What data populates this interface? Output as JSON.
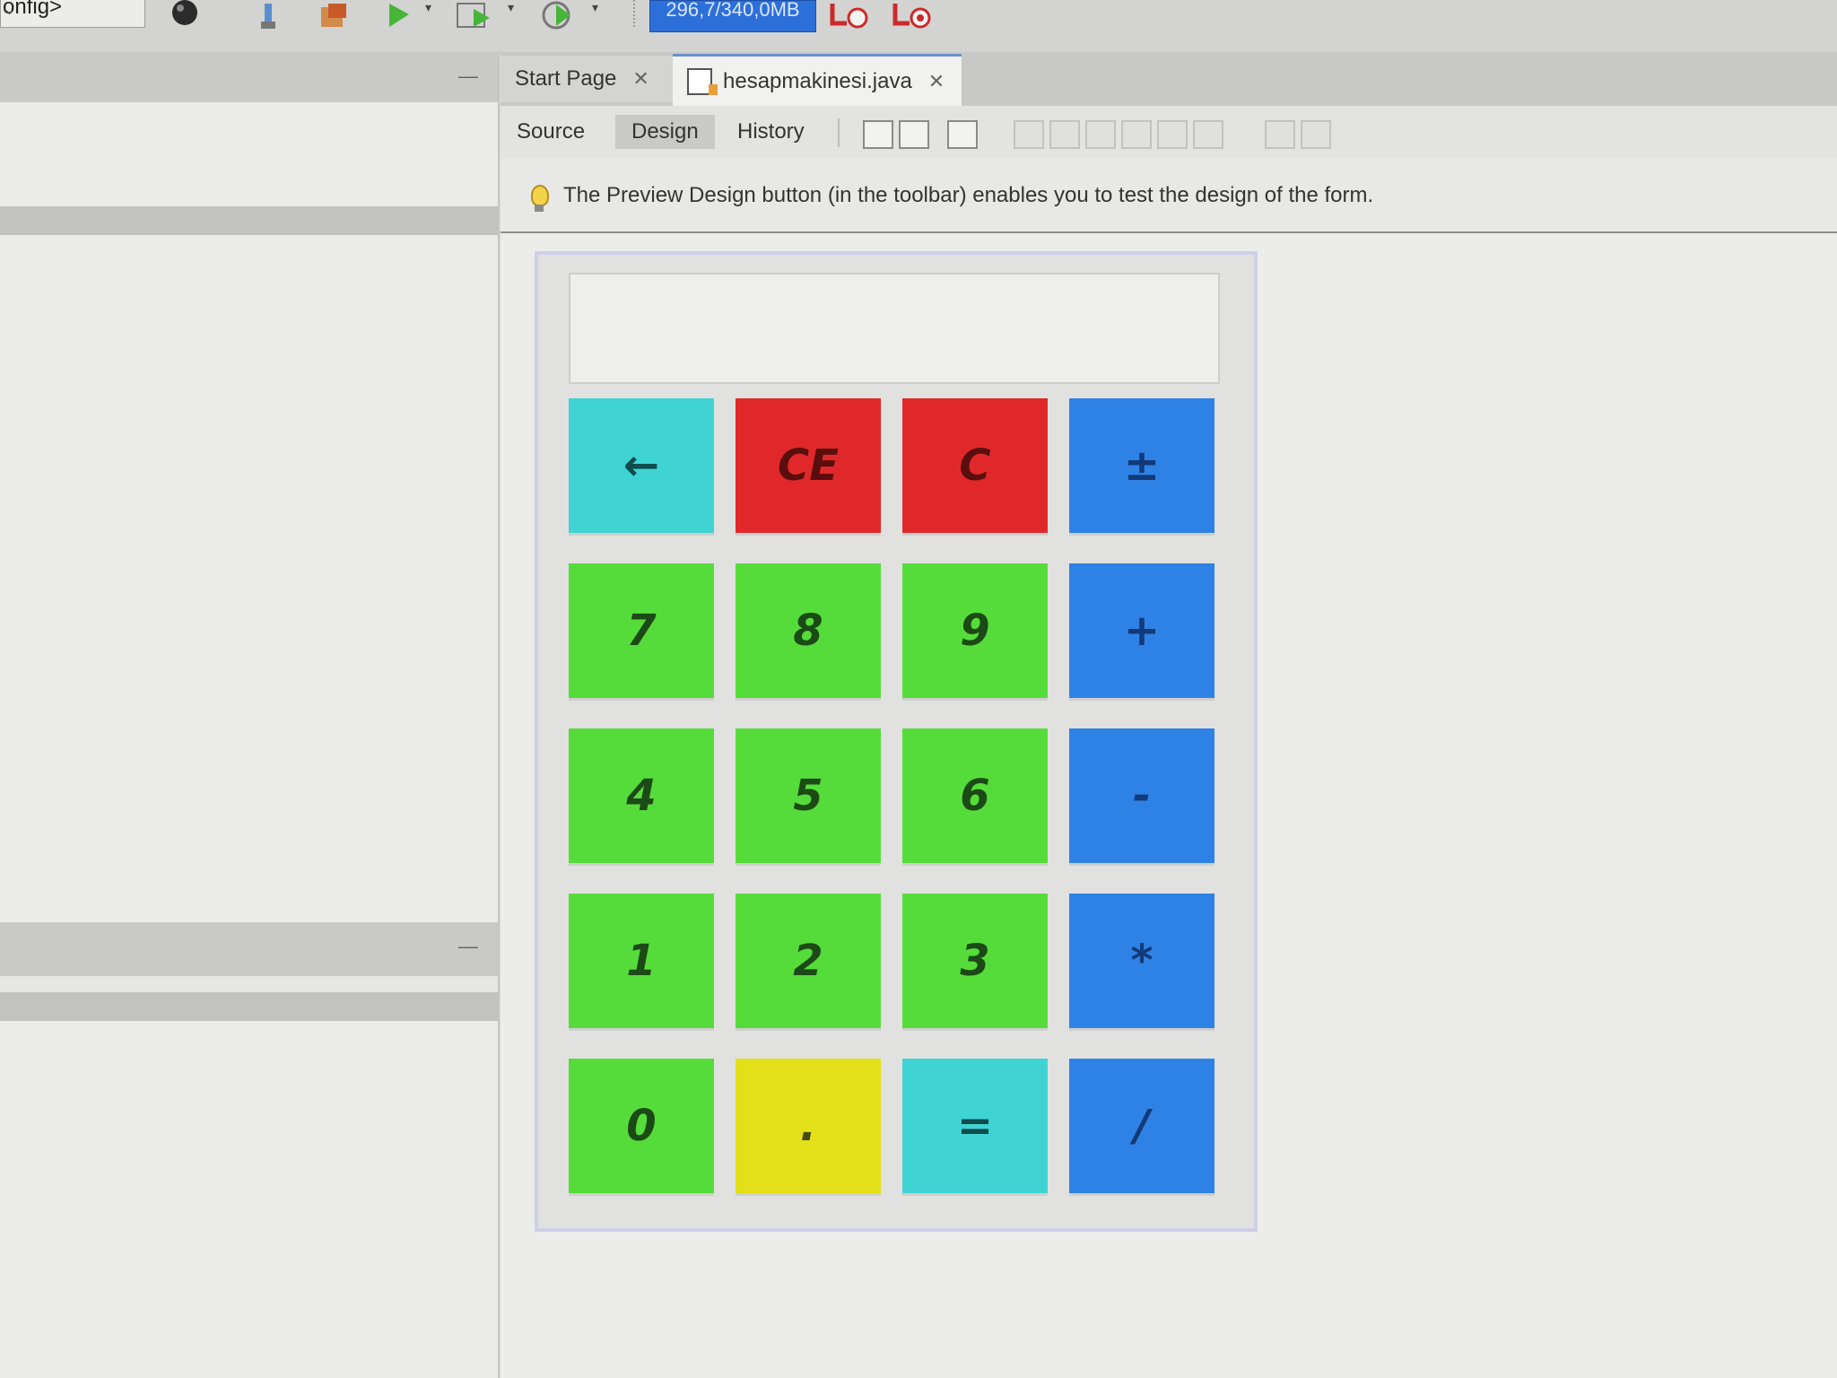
{
  "toolbar": {
    "config_text": "onfig>",
    "memory_label": "296,7/340,0MB"
  },
  "editor": {
    "tabs": [
      {
        "label": "Start Page"
      },
      {
        "label": "hesapmakinesi.java"
      }
    ],
    "views": {
      "source": "Source",
      "design": "Design",
      "history": "History"
    },
    "hint_text": "The Preview Design button (in the toolbar) enables you to test the design of the form."
  },
  "calculator": {
    "display_value": "",
    "keys": [
      {
        "label": "←",
        "color": "#3fd4d3"
      },
      {
        "label": "CE",
        "color": "#e0282a"
      },
      {
        "label": "C",
        "color": "#e0282a"
      },
      {
        "label": "±",
        "color": "#2e82e6"
      },
      {
        "label": "7",
        "color": "#56dc3a"
      },
      {
        "label": "8",
        "color": "#56dc3a"
      },
      {
        "label": "9",
        "color": "#56dc3a"
      },
      {
        "label": "+",
        "color": "#2e82e6"
      },
      {
        "label": "4",
        "color": "#56dc3a"
      },
      {
        "label": "5",
        "color": "#56dc3a"
      },
      {
        "label": "6",
        "color": "#56dc3a"
      },
      {
        "label": "-",
        "color": "#2e82e6"
      },
      {
        "label": "1",
        "color": "#56dc3a"
      },
      {
        "label": "2",
        "color": "#56dc3a"
      },
      {
        "label": "3",
        "color": "#56dc3a"
      },
      {
        "label": "*",
        "color": "#2e82e6"
      },
      {
        "label": "0",
        "color": "#56dc3a"
      },
      {
        "label": ".",
        "color": "#e3e01a"
      },
      {
        "label": "=",
        "color": "#3fd4d3"
      },
      {
        "label": "/",
        "color": "#2e82e6"
      }
    ]
  }
}
